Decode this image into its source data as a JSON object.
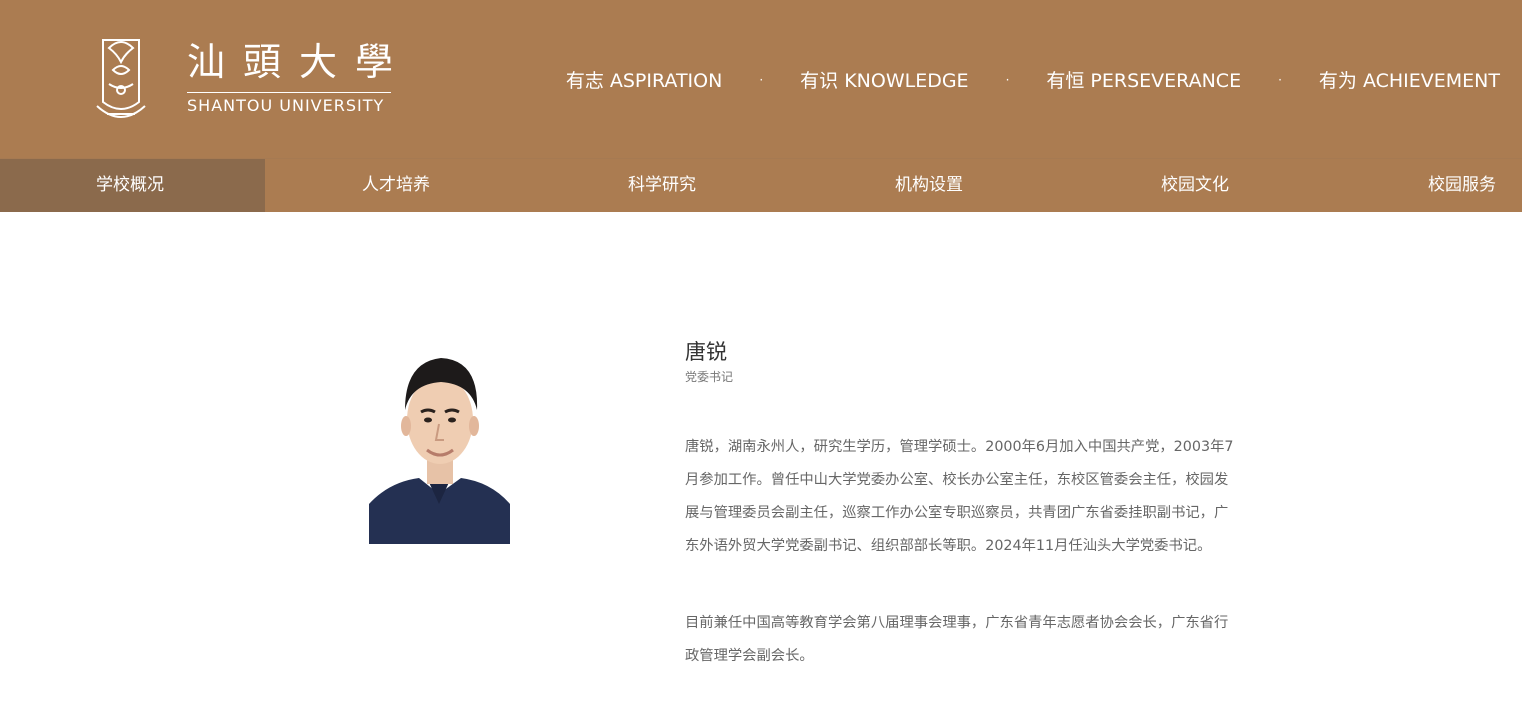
{
  "logo": {
    "cn": "汕頭大學",
    "en": "SHANTOU UNIVERSITY"
  },
  "mottos": [
    "有志 ASPIRATION",
    "有识 KNOWLEDGE",
    "有恒 PERSEVERANCE",
    "有为 ACHIEVEMENT"
  ],
  "separator": "·",
  "nav": [
    "学校概况",
    "人才培养",
    "科学研究",
    "机构设置",
    "校园文化",
    "校园服务"
  ],
  "profile": {
    "name": "唐锐",
    "title": "党委书记",
    "bio": [
      "唐锐，湖南永州人，研究生学历，管理学硕士。2000年6月加入中国共产党，2003年7月参加工作。曾任中山大学党委办公室、校长办公室主任，东校区管委会主任，校园发展与管理委员会副主任，巡察工作办公室专职巡察员，共青团广东省委挂职副书记，广东外语外贸大学党委副书记、组织部部长等职。2024年11月任汕头大学党委书记。",
      "目前兼任中国高等教育学会第八届理事会理事，广东省青年志愿者协会会长，广东省行政管理学会副会长。"
    ]
  },
  "colors": {
    "header_bg": "#ab7c51",
    "nav_active_bg": "#8b6a4c"
  }
}
